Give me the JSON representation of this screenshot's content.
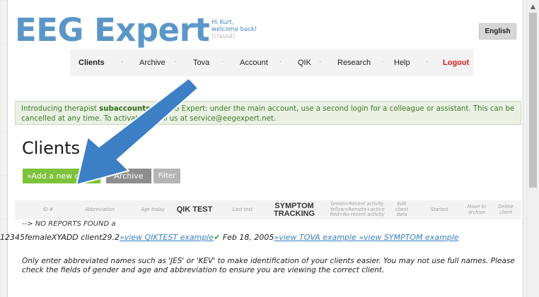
{
  "header": {
    "logo": "EEG Expert",
    "greeting_line1": "Hi Kurt,",
    "greeting_line2": "welcome back!",
    "greeting_line3": "(class4)",
    "language_button": "English"
  },
  "nav": {
    "items": [
      {
        "label": "Clients"
      },
      {
        "label": "Archive"
      },
      {
        "label": "Tova"
      },
      {
        "label": "Account"
      },
      {
        "label": "QIK"
      },
      {
        "label": "Research"
      },
      {
        "label": "Help"
      },
      {
        "label": "Logout"
      }
    ],
    "separator": "·"
  },
  "notice": {
    "prefix": "Introducing therapist ",
    "highlight": "subaccounts",
    "middle": " for EEG Expert: under the main account, use a second login for a colleague or assistant. This can be cancelled at any time. To activate, email us at service@eegexpert.net."
  },
  "main": {
    "title": "Clients",
    "buttons": {
      "add": "»Add a new client",
      "archive": "Archive",
      "filter": "Filter"
    }
  },
  "table": {
    "headers": {
      "id": "ID #",
      "abbreviation": "Abbreviation",
      "age_today": "Age today",
      "qik_test": "QIK TEST",
      "last_test": "Last test",
      "symptom_tracking_1": "SYMPTOM",
      "symptom_tracking_2": "TRACKING",
      "activity_1": "Green=Recent activity",
      "activity_2": "Yellow=Remote+active",
      "activity_3": "Red=No recent activity",
      "edit_1": "Edit",
      "edit_2": "client",
      "edit_3": "data",
      "started": "Started",
      "move_1": "Move to",
      "move_2": "archive",
      "delete_1": "Delete",
      "delete_2": "client"
    },
    "no_reports": "--> NO REPORTS FOUND a",
    "row": {
      "prefix": "12345femaleXYADD client29.2",
      "qik_link": "»view QIKTEST example",
      "checkmark": "✔",
      "date": " Feb 18, 2005",
      "tova_link": "»view TOVA example",
      "symptom_link": " »view SYMPTOM example"
    }
  },
  "help_text": "Only enter abbreviated names such as 'JES' or 'KEV' to make identification of your clients easier. You may not use full names. Please check the fields of gender and age and abbreviation to ensure you are viewing the correct client.",
  "colors": {
    "logo": "#5b96c8",
    "add_button": "#7cc23a",
    "logout": "#d81b1b",
    "arrow": "#3d7fc4",
    "notice_bg": "#eaf1e3",
    "link": "#3b7fbf"
  }
}
